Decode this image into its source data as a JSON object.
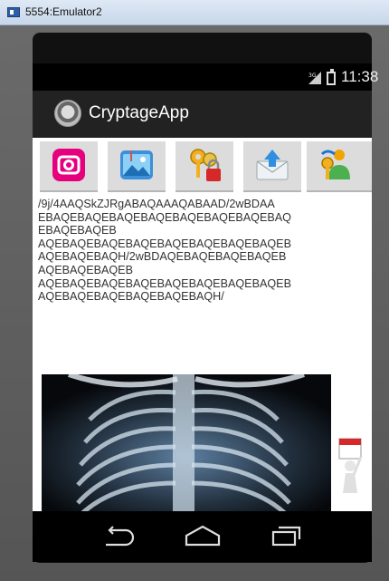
{
  "window": {
    "title": "5554:Emulator2"
  },
  "status_bar": {
    "signal": "3G",
    "time": "11:38"
  },
  "action_bar": {
    "app_name": "CryptageApp"
  },
  "toolbar": {
    "buttons": [
      {
        "name": "camera-button",
        "icon": "camera-icon"
      },
      {
        "name": "gallery-button",
        "icon": "image-icon"
      },
      {
        "name": "encrypt-button",
        "icon": "keys-lock-icon"
      },
      {
        "name": "upload-button",
        "icon": "upload-mail-icon"
      },
      {
        "name": "decrypt-button",
        "icon": "user-key-icon"
      }
    ]
  },
  "encoded_text": "/9j/4AAQSkZJRgABAQAAAQABAAD/2wBDAA\nEBAQEBAQEBAQEBAQEBAQEBAQEBAQEBAQ\nEBAQEBAQEB\nAQEBAQEBAQEBAQEBAQEBAQEBAQEBAQEB\nAQEBAQEBAQH/2wBDAQEBAQEBAQEBAQEB\nAQEBAQEBAQEB\nAQEBAQEBAQEBAQEBAQEBAQEBAQEBAQEB\nAQEBAQEBAQEBAQEBAQEBAQH/",
  "colors": {
    "accent_pink": "#e6007e",
    "action_bar": "#222222",
    "status_bar": "#000000"
  }
}
